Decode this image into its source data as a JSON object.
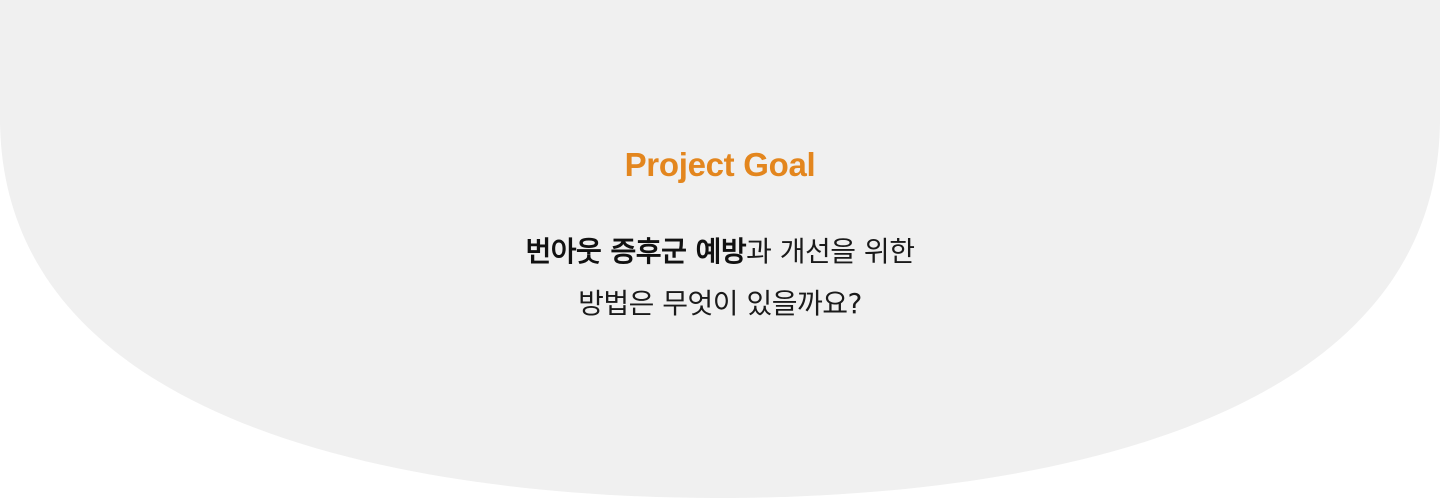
{
  "section": {
    "eyebrow": "Project Goal",
    "headline": {
      "line1_bold": "번아웃 증후군 예방",
      "line1_rest": "과 개선을 위한",
      "line2": "방법은 무엇이 있을까요?"
    },
    "colors": {
      "accent": "#E3861E",
      "panel_background": "#F0F0F0",
      "page_background": "#FFFFFF",
      "text": "#111111"
    }
  }
}
